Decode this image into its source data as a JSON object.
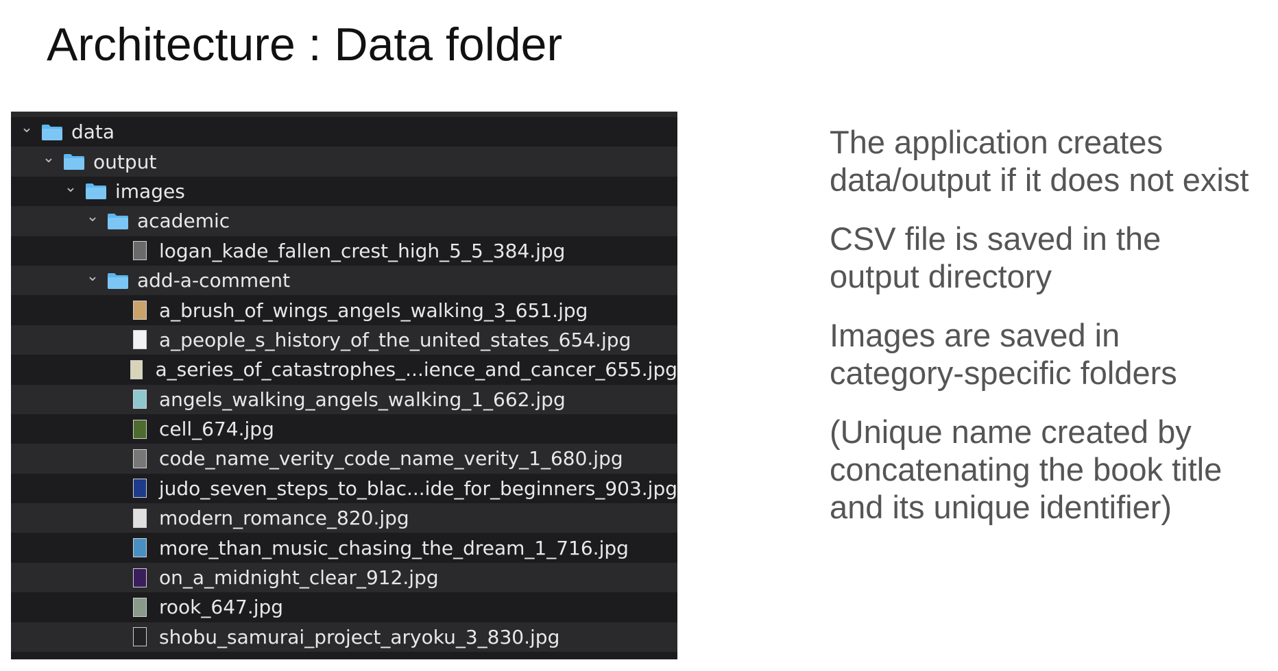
{
  "slide": {
    "title": "Architecture : Data folder",
    "bullets": [
      "The application creates data/output if it does not exist",
      "CSV file is saved in the output directory",
      "Images are saved in category-specific folders",
      "(Unique name created by concatenating the book title and its unique identifier)"
    ]
  },
  "finder": {
    "colors": {
      "background": "#1e1e1f",
      "row_alt": "#2a2a2c",
      "folder": "#5fb6ee",
      "text": "#e8e8e8"
    },
    "rows": [
      {
        "label": "data",
        "type": "folder",
        "expanded": true,
        "depth": 0,
        "icon": "folder-icon"
      },
      {
        "label": "output",
        "type": "folder",
        "expanded": true,
        "depth": 1,
        "icon": "folder-icon"
      },
      {
        "label": "images",
        "type": "folder",
        "expanded": true,
        "depth": 2,
        "icon": "folder-icon"
      },
      {
        "label": "academic",
        "type": "folder",
        "expanded": true,
        "depth": 3,
        "icon": "folder-icon"
      },
      {
        "label": "logan_kade_fallen_crest_high_5_5_384.jpg",
        "type": "file",
        "depth": 4,
        "icon": "image-file-icon",
        "thumb": "#6a6a6a"
      },
      {
        "label": "add-a-comment",
        "type": "folder",
        "expanded": true,
        "depth": 3,
        "icon": "folder-icon"
      },
      {
        "label": "a_brush_of_wings_angels_walking_3_651.jpg",
        "type": "file",
        "depth": 4,
        "icon": "image-file-icon",
        "thumb": "#c9a36a"
      },
      {
        "label": "a_people_s_history_of_the_united_states_654.jpg",
        "type": "file",
        "depth": 4,
        "icon": "image-file-icon",
        "thumb": "#f2f2f2"
      },
      {
        "label": "a_series_of_catastrophes_...ience_and_cancer_655.jpg",
        "type": "file",
        "depth": 4,
        "icon": "image-file-icon",
        "thumb": "#d8d4b8"
      },
      {
        "label": "angels_walking_angels_walking_1_662.jpg",
        "type": "file",
        "depth": 4,
        "icon": "image-file-icon",
        "thumb": "#8fc7cf"
      },
      {
        "label": "cell_674.jpg",
        "type": "file",
        "depth": 4,
        "icon": "image-file-icon",
        "thumb": "#4d6b2e"
      },
      {
        "label": "code_name_verity_code_name_verity_1_680.jpg",
        "type": "file",
        "depth": 4,
        "icon": "image-file-icon",
        "thumb": "#777777"
      },
      {
        "label": "judo_seven_steps_to_blac...ide_for_beginners_903.jpg",
        "type": "file",
        "depth": 4,
        "icon": "image-file-icon",
        "thumb": "#1e3a8a"
      },
      {
        "label": "modern_romance_820.jpg",
        "type": "file",
        "depth": 4,
        "icon": "image-file-icon",
        "thumb": "#e0e0e0"
      },
      {
        "label": "more_than_music_chasing_the_dream_1_716.jpg",
        "type": "file",
        "depth": 4,
        "icon": "image-file-icon",
        "thumb": "#4a8fc2"
      },
      {
        "label": "on_a_midnight_clear_912.jpg",
        "type": "file",
        "depth": 4,
        "icon": "image-file-icon",
        "thumb": "#3a1e5c"
      },
      {
        "label": "rook_647.jpg",
        "type": "file",
        "depth": 4,
        "icon": "image-file-icon",
        "thumb": "#8a9a8a"
      },
      {
        "label": "shobu_samurai_project_aryoku_3_830.jpg",
        "type": "file",
        "depth": 4,
        "icon": "image-file-icon",
        "thumb": "#222222"
      }
    ]
  }
}
